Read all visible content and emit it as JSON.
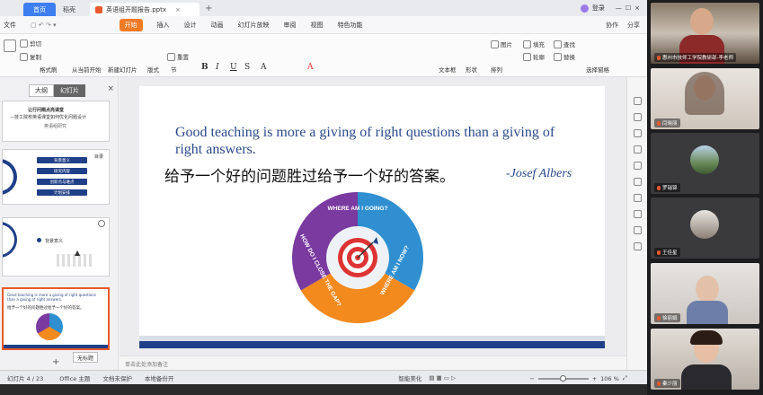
{
  "titlebar": {
    "home_tab": "首页",
    "shell_tab": "稻壳",
    "doc_tab": "英语组开题报告.pptx",
    "user_label": "登录"
  },
  "menu": {
    "file": "文件",
    "items": [
      "开始",
      "插入",
      "设计",
      "动画",
      "幻灯片放映",
      "审阅",
      "视图",
      "特色功能"
    ],
    "right": [
      "协作",
      "分享"
    ]
  },
  "ribbon": {
    "cut": "剪切",
    "copy": "复制",
    "format_painter": "格式刷",
    "from_start": "从当前开始",
    "new_slide": "新建幻灯片",
    "layout": "版式",
    "section": "节",
    "reset": "重置",
    "textbox": "文本框",
    "shape": "形状",
    "arrange": "排列",
    "image": "图片",
    "fill": "填充",
    "outline": "轮廓",
    "find": "查找",
    "replace": "替换",
    "select_pane": "选择窗格"
  },
  "sidebar": {
    "tab_outline": "大纲",
    "tab_slides": "幻灯片",
    "thumb1_title": "让行问题点亮课堂",
    "thumb1_sub": "—技工院校英语课堂如何优化问题设计",
    "thumb1_author": "英语组研究",
    "thumb2_items": [
      "背景意义",
      "研究内容",
      "创新点与难点",
      "计划安排"
    ],
    "thumb2_label": "目录",
    "thumb3_label": "背景意义",
    "thumb4_en": "Good teaching is more a giving of right questions than a giving of right answers.",
    "thumb4_cn": "给予一个好的问题胜过给予一个好的答案。",
    "tooltip": "无标题"
  },
  "slide": {
    "quote_en": "Good teaching is more a giving of right questions than a giving of right answers.",
    "quote_cn": "给予一个好的问题胜过给予一个好的答案。",
    "author": "-Josef Albers",
    "wheel": {
      "top": "WHERE AM I GOING?",
      "right": "WHERE AM I NOW?",
      "left": "HOW DO I CLOSE THE GAP?"
    },
    "colors": {
      "blue": "#2f8fd0",
      "orange": "#f38a1e",
      "purple": "#7a3aa0",
      "navy": "#1f3f88"
    }
  },
  "notes_placeholder": "单击此处添加备注",
  "status": {
    "slide_count": "幻灯片 4 / 23",
    "theme": "Office 主题",
    "protect": "文档未保护",
    "backup": "本地备份开",
    "beautify": "智能美化",
    "zoom": "106 %"
  },
  "participants": [
    {
      "name": "惠州市技师工学院教研部-李老师"
    },
    {
      "name": "闫晓丽"
    },
    {
      "name": "罗瑞锦"
    },
    {
      "name": "王佳星"
    },
    {
      "name": "徐丽娟"
    },
    {
      "name": "秦少丽"
    }
  ]
}
